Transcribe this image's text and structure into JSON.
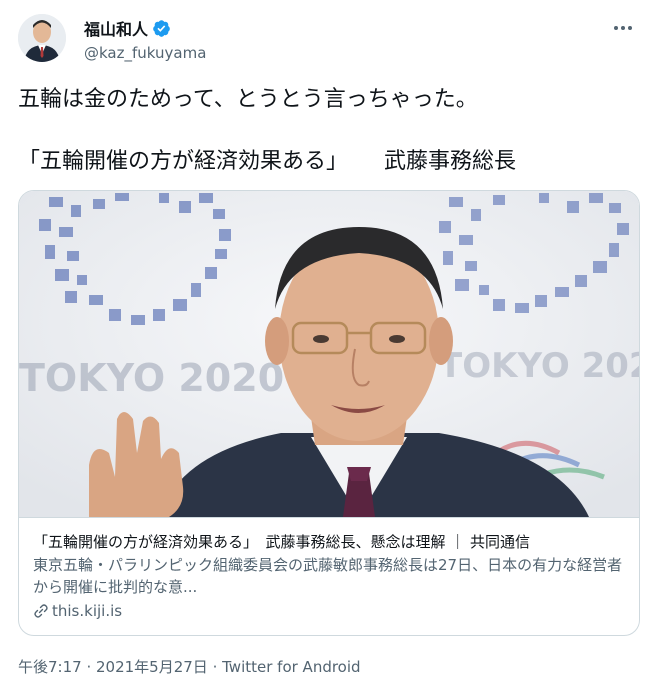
{
  "author": {
    "display_name": "福山和人",
    "handle": "@kaz_fukuyama",
    "verified": true,
    "avatar_icon": "person-avatar"
  },
  "tweet": {
    "line1": "五輪は金のためって、とうとう言っちゃった。",
    "line2_a": "「五輪開催の方が経済効果ある」",
    "line2_b": "武藤事務総長"
  },
  "card": {
    "title": "「五輪開催の方が経済効果ある」　武藤事務総長、懸念は理解 ｜ 共同通信",
    "description": "東京五輪・パラリンピック組織委員会の武藤敏郎事務総長は27日、日本の有力な経営者から開催に批判的な意...",
    "domain": "this.kiji.is",
    "image_caption_text": "TOKYO 2020"
  },
  "meta": {
    "time": "午後7:17",
    "date": "2021年5月27日",
    "separator": " · ",
    "source": "Twitter for Android"
  },
  "colors": {
    "text_primary": "#0f1419",
    "text_secondary": "#536471",
    "verified_blue": "#1d9bf0",
    "border": "#cfd9de",
    "emblem_indigo": "#1f3b8c"
  }
}
